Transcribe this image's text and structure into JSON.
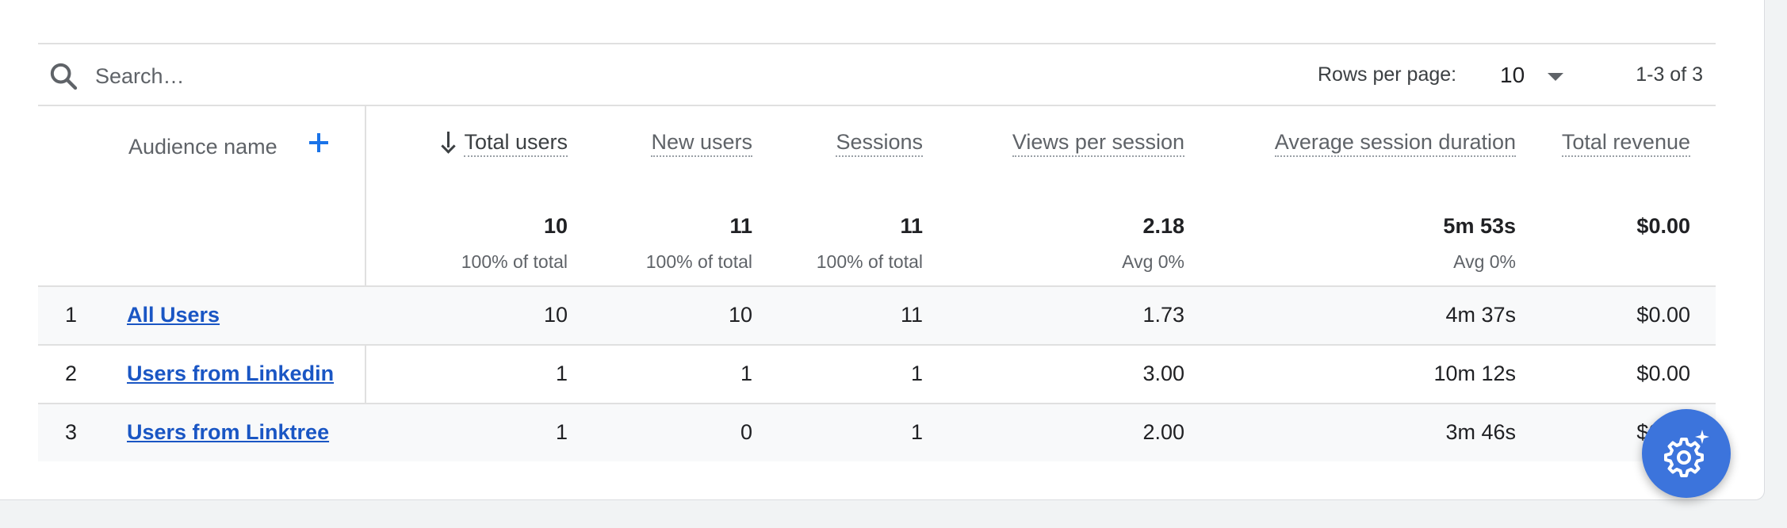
{
  "toolbar": {
    "search_placeholder": "Search…",
    "rows_per_page_label": "Rows per page:",
    "rows_per_page_value": "10",
    "range_text": "1-3 of 3"
  },
  "table": {
    "dimension_header": "Audience name",
    "columns": [
      {
        "label": "Total users",
        "total": "10",
        "total_sub": "100% of total"
      },
      {
        "label": "New users",
        "total": "11",
        "total_sub": "100% of total"
      },
      {
        "label": "Sessions",
        "total": "11",
        "total_sub": "100% of total"
      },
      {
        "label": "Views per session",
        "total": "2.18",
        "total_sub": "Avg 0%"
      },
      {
        "label": "Average session duration",
        "total": "5m 53s",
        "total_sub": "Avg 0%"
      },
      {
        "label": "Total revenue",
        "total": "$0.00",
        "total_sub": ""
      }
    ],
    "rows": [
      {
        "index": "1",
        "name": "All Users",
        "values": [
          "10",
          "10",
          "11",
          "1.73",
          "4m 37s",
          "$0.00"
        ]
      },
      {
        "index": "2",
        "name": "Users from Linkedin",
        "values": [
          "1",
          "1",
          "1",
          "3.00",
          "10m 12s",
          "$0.00"
        ]
      },
      {
        "index": "3",
        "name": "Users from Linktree",
        "values": [
          "1",
          "0",
          "1",
          "2.00",
          "3m 46s",
          "$0.00"
        ]
      }
    ]
  },
  "colors": {
    "accent": "#1a73e8",
    "link": "#1a56c4",
    "fab": "#3c74dc"
  },
  "icons": [
    "search-icon",
    "add-icon",
    "sort-down-icon",
    "dropdown-caret-icon",
    "settings-sparkle-icon"
  ]
}
